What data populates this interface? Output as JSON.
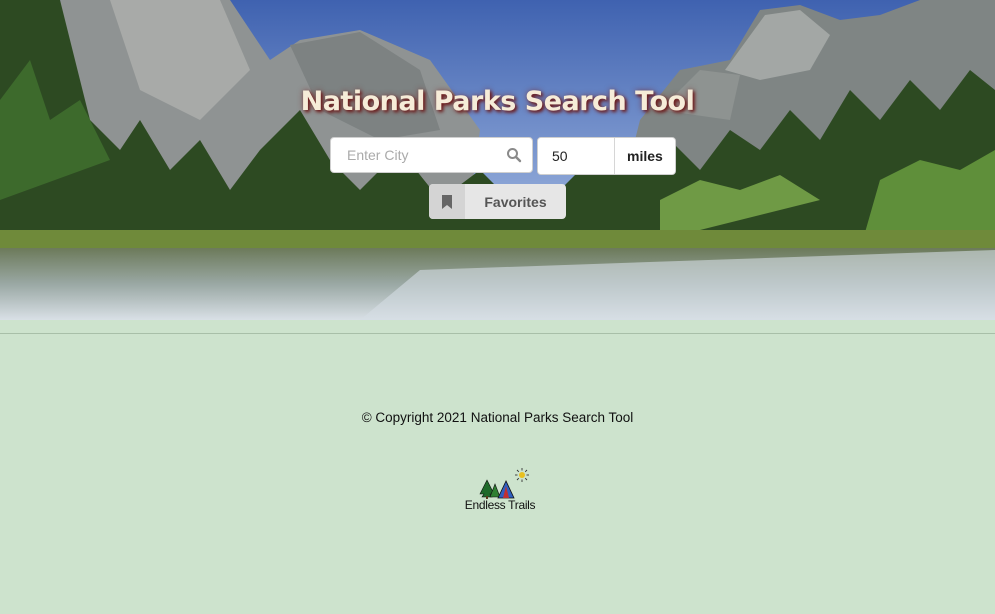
{
  "header": {
    "title": "National Parks Search Tool"
  },
  "search": {
    "city_placeholder": "Enter City",
    "city_value": "",
    "radius_value": "50",
    "radius_unit": "miles"
  },
  "favorites": {
    "label": "Favorites"
  },
  "footer": {
    "copyright": "© Copyright 2021 National Parks Search Tool",
    "logo_text": "Endless Trails"
  },
  "icons": {
    "search": "search-icon",
    "bookmark": "bookmark-icon"
  },
  "colors": {
    "footer_bg": "#cde3cd",
    "title_text": "#f6ecd8",
    "title_shadow": "#6b1a1a"
  }
}
